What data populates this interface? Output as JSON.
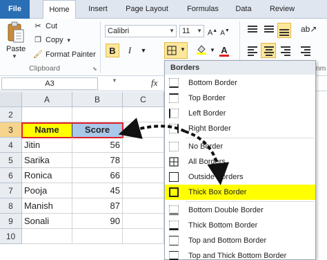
{
  "tabs": [
    "File",
    "Home",
    "Insert",
    "Page Layout",
    "Formulas",
    "Data",
    "Review"
  ],
  "clipboard": {
    "paste": "Paste",
    "cut": "Cut",
    "copy": "Copy",
    "format_painter": "Format Painter",
    "group_label": "Clipboard"
  },
  "font": {
    "family": "Calibri",
    "size": "11",
    "bold": "B",
    "italic": "I",
    "group_label_partial": "gnm"
  },
  "formula_bar": {
    "name_box": "A3",
    "fx": "fx"
  },
  "grid": {
    "columns": [
      "A",
      "B",
      "C"
    ],
    "rows": [
      "2",
      "3",
      "4",
      "5",
      "6",
      "7",
      "8",
      "9",
      "10"
    ],
    "header": {
      "name": "Name",
      "score": "Score"
    },
    "records": [
      {
        "name": "Jitin",
        "score": "56"
      },
      {
        "name": "Sarika",
        "score": "78"
      },
      {
        "name": "Ronica",
        "score": "66"
      },
      {
        "name": "Pooja",
        "score": "45"
      },
      {
        "name": "Manish",
        "score": "87"
      },
      {
        "name": "Sonali",
        "score": "90"
      }
    ]
  },
  "borders_menu": {
    "title": "Borders",
    "items": [
      "Bottom Border",
      "Top Border",
      "Left Border",
      "Right Border",
      "No Border",
      "All Borders",
      "Outside Borders",
      "Thick Box Border",
      "Bottom Double Border",
      "Thick Bottom Border",
      "Top and Bottom Border",
      "Top and Thick Bottom Border"
    ],
    "highlighted_item": "Thick Box Border",
    "highlight_color": "#ffff00"
  },
  "colors": {
    "file_tab": "#2a6fb5",
    "ribbon_highlight": "#fde79a",
    "header_fill": "#ffff00",
    "score_fill": "#a9c8ea",
    "selection_border": "#e0202b"
  }
}
